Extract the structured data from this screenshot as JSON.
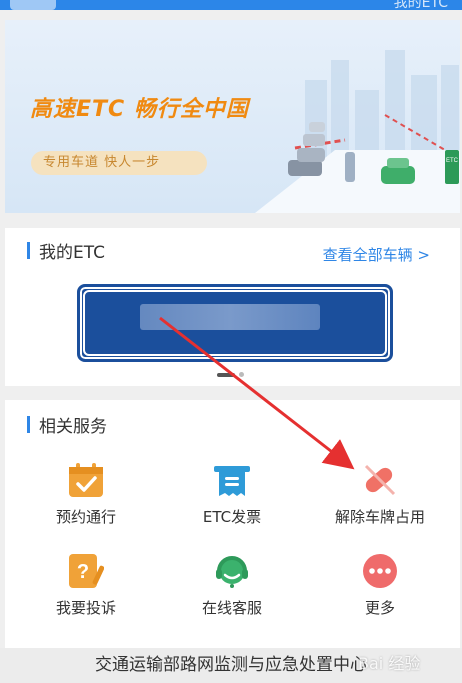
{
  "status_bar": {
    "right_text": "我的ETC"
  },
  "banner": {
    "title": "高速ETC  畅行全中国",
    "subtitle": "专用车道   快人一步"
  },
  "my_etc": {
    "title": "我的ETC",
    "view_all": "查看全部车辆 >"
  },
  "services": {
    "title": "相关服务",
    "items": [
      {
        "label": "预约通行",
        "icon": "calendar-check-icon",
        "color": "#f0a238"
      },
      {
        "label": "ETC发票",
        "icon": "invoice-icon",
        "color": "#2e9bd8"
      },
      {
        "label": "解除车牌占用",
        "icon": "unbind-plate-icon",
        "color": "#f07166"
      },
      {
        "label": "我要投诉",
        "icon": "complaint-icon",
        "color": "#f0a238"
      },
      {
        "label": "在线客服",
        "icon": "headset-icon",
        "color": "#3bb26d"
      },
      {
        "label": "更多",
        "icon": "more-icon",
        "color": "#ef6b6b"
      }
    ]
  },
  "footer": {
    "text": "交通运输部路网监测与应急处置中心"
  },
  "watermark": {
    "text": "Bai 经验"
  }
}
